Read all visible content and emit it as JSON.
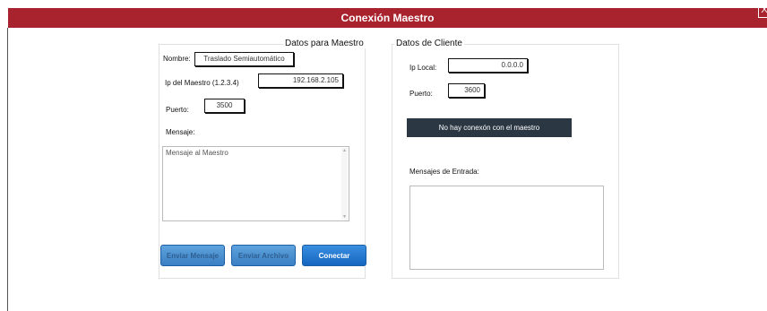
{
  "window": {
    "title": "Conexión Maestro",
    "close_label": "X"
  },
  "master_panel": {
    "legend": "Datos para Maestro",
    "name_label": "Nombre:",
    "name_value": "Traslado Semiautomático",
    "ip_label": "Ip del Maestro (1.2.3.4)",
    "ip_value": "192.168.2.105",
    "port_label": "Puerto:",
    "port_value": "3500",
    "message_label": "Mensaje:",
    "message_value": "Mensaje al Maestro",
    "send_message_button": "Enviar Mensaje",
    "send_file_button": "Enviar Archivo",
    "connect_button": "Conectar"
  },
  "client_panel": {
    "legend": "Datos de Cliente",
    "ip_label": "Ip Local:",
    "ip_value": "0.0.0.0",
    "port_label": "Puerto:",
    "port_value": "3600",
    "status_text": "No hay conexón con el maestro",
    "incoming_label": "Mensajes de Entrada:",
    "incoming_value": ""
  }
}
